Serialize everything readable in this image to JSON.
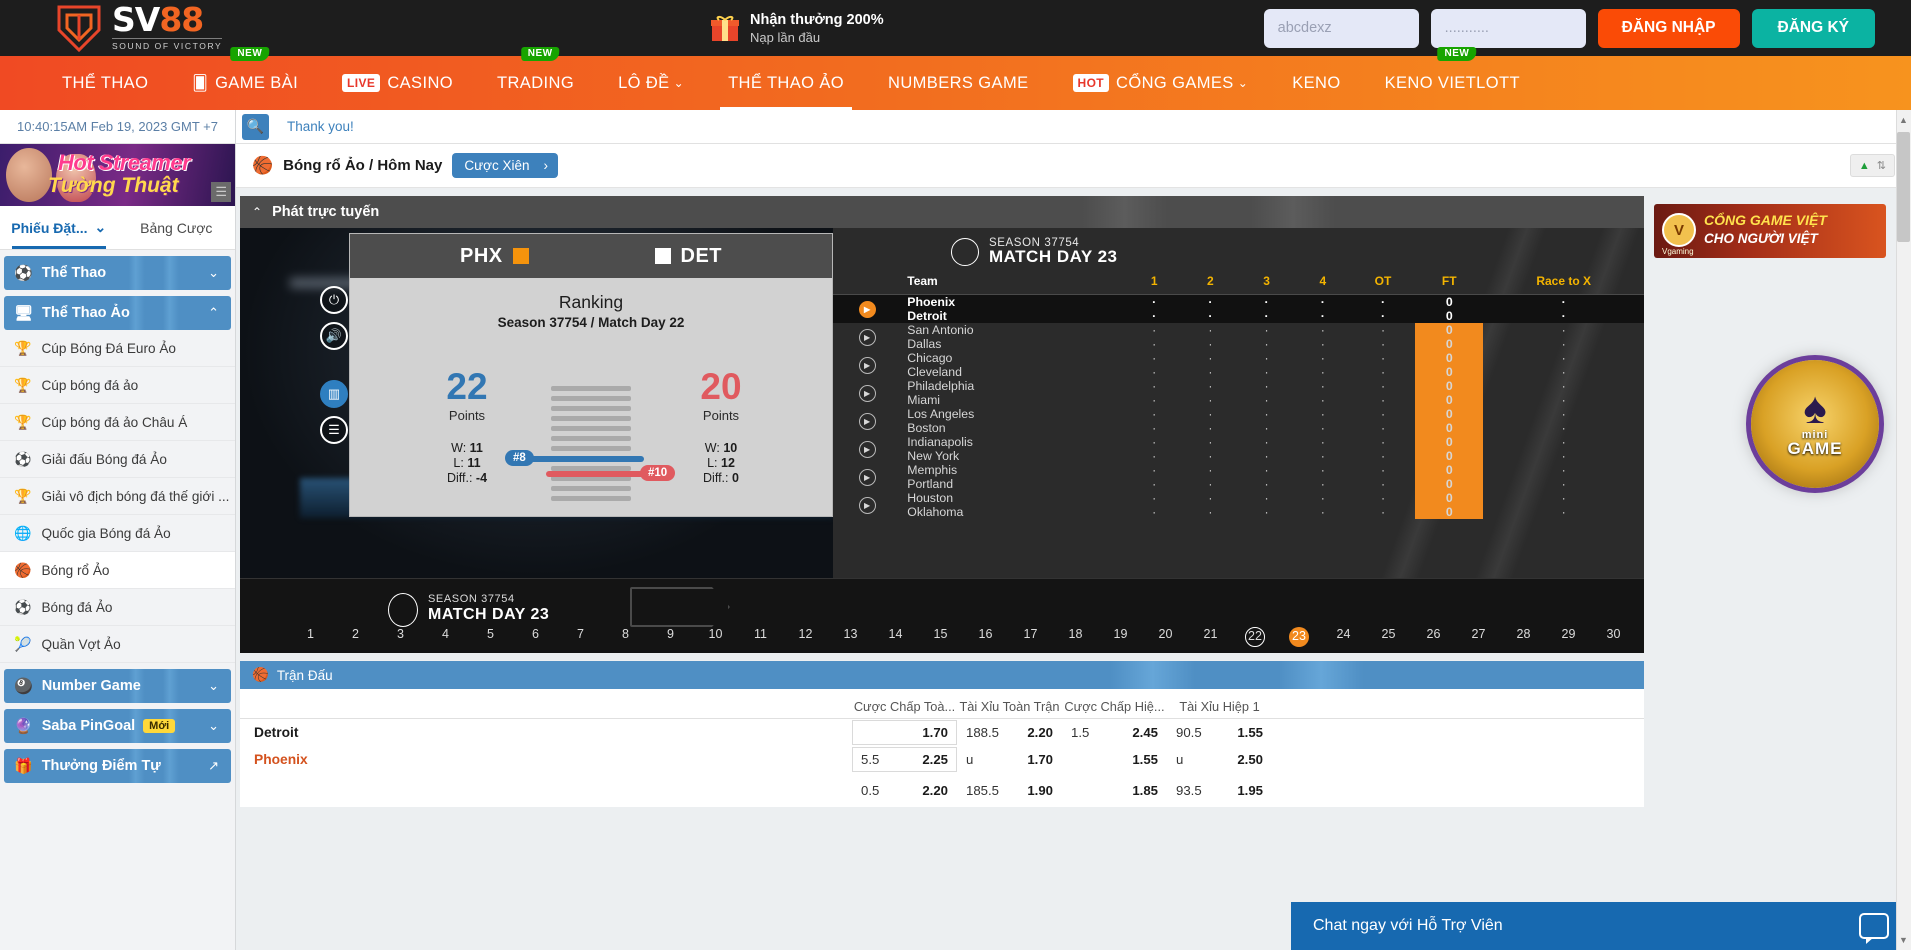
{
  "header": {
    "logo_name": "SV88",
    "logo_tagline": "SOUND OF VICTORY",
    "promo_title": "Nhận thưởng 200%",
    "promo_sub": "Nạp lần đầu",
    "username_value": "abcdexz",
    "username_placeholder": "abcdexz",
    "password_value": "...........",
    "login_label": "ĐĂNG NHẬP",
    "register_label": "ĐĂNG KÝ",
    "accent_orange": "#fa4b06",
    "accent_teal": "#0bb3a2"
  },
  "nav": {
    "items": [
      {
        "label": "THỂ THAO",
        "icon": "",
        "badge": "",
        "tag": "",
        "active": false
      },
      {
        "label": "GAME BÀI",
        "icon": "card-icon",
        "badge": "NEW",
        "tag": "",
        "active": false
      },
      {
        "label": "CASINO",
        "icon": "",
        "badge": "",
        "tag": "LIVE",
        "active": false
      },
      {
        "label": "TRADING",
        "icon": "",
        "badge": "NEW",
        "tag": "",
        "active": false
      },
      {
        "label": "LÔ ĐỀ",
        "icon": "",
        "badge": "",
        "tag": "",
        "caret": true,
        "active": false
      },
      {
        "label": "THỂ THAO ẢO",
        "icon": "",
        "badge": "",
        "tag": "",
        "active": true
      },
      {
        "label": "NUMBERS GAME",
        "icon": "",
        "badge": "",
        "tag": "",
        "active": false
      },
      {
        "label": "CỔNG GAMES",
        "icon": "",
        "badge": "",
        "tag": "HOT",
        "caret": true,
        "active": false
      },
      {
        "label": "KENO",
        "icon": "",
        "badge": "",
        "tag": "",
        "active": false
      },
      {
        "label": "KENO VIETLOTT",
        "icon": "",
        "badge": "NEW",
        "tag": "",
        "active": false
      }
    ]
  },
  "sidebar": {
    "clock": "10:40:15AM Feb 19, 2023 GMT +7",
    "banner_line1": "Hot Streamer",
    "banner_line2": "Tường Thuật",
    "tabs": [
      {
        "label": "Phiếu Đặt...",
        "active": true
      },
      {
        "label": "Bảng Cược",
        "active": false
      }
    ],
    "groups": [
      {
        "label": "Thể Thao",
        "icon": "sports-ball-icon",
        "expanded": false,
        "badge": "",
        "items": []
      },
      {
        "label": "Thể Thao Ảo",
        "icon": "virtual-sports-icon",
        "expanded": true,
        "badge": "",
        "items": [
          {
            "label": "Cúp Bóng Đá Euro Ảo",
            "icon": "trophy-icon",
            "selected": false
          },
          {
            "label": "Cúp bóng đá ảo",
            "icon": "trophy-icon",
            "selected": false
          },
          {
            "label": "Cúp bóng đá ảo Châu Á",
            "icon": "trophy-icon",
            "selected": false
          },
          {
            "label": "Giải đấu Bóng đá Ảo",
            "icon": "soccer-icon",
            "selected": false
          },
          {
            "label": "Giải vô địch bóng đá thế giới ...",
            "icon": "trophy-icon",
            "selected": false
          },
          {
            "label": "Quốc gia Bóng đá Ảo",
            "icon": "globe-soccer-icon",
            "selected": false
          },
          {
            "label": "Bóng rổ Ảo",
            "icon": "basketball-icon",
            "selected": true
          },
          {
            "label": "Bóng đá Ảo",
            "icon": "soccer-icon",
            "selected": false
          },
          {
            "label": "Quần Vợt Ảo",
            "icon": "tennis-icon",
            "selected": false
          }
        ]
      },
      {
        "label": "Number Game",
        "icon": "balls-icon",
        "expanded": false,
        "badge": "",
        "items": []
      },
      {
        "label": "Saba PinGoal",
        "icon": "pin-icon",
        "expanded": false,
        "badge": "Mới",
        "items": []
      },
      {
        "label": "Thưởng Điểm Tự",
        "icon": "gift-icon",
        "expanded": false,
        "badge": "",
        "items": []
      }
    ]
  },
  "search": {
    "icon": "search-icon",
    "message": "Thank you!"
  },
  "breadcrumb": {
    "icon": "basketball-icon",
    "text": "Bóng rổ Ảo / Hôm Nay",
    "pill_label": "Cược Xiên",
    "pill_arrow": "›",
    "sort_up": "▲",
    "sort_down": "⇅"
  },
  "stream": {
    "title": "Phát trực tuyến",
    "collapse_icon": "chevron-up-icon",
    "controls": [
      "power-icon",
      "volume-icon",
      "stats-icon",
      "list-icon"
    ]
  },
  "overlay": {
    "team_left": "PHX",
    "team_right": "DET",
    "color_left": "#f5930c",
    "color_right": "#ffffff",
    "title": "Ranking",
    "subtitle": "Season 37754 / Match Day 22",
    "left": {
      "points": "22",
      "points_label": "Points",
      "w_label": "W:",
      "w": "11",
      "l_label": "L:",
      "l": "11",
      "diff_label": "Diff.:",
      "diff": "-4",
      "rank": "#8",
      "color": "#3277b3"
    },
    "right": {
      "points": "20",
      "points_label": "Points",
      "w_label": "W:",
      "w": "10",
      "l_label": "L:",
      "l": "12",
      "diff_label": "Diff.:",
      "diff": "0",
      "rank": "#10",
      "color": "#e05a5f"
    }
  },
  "scoreboard": {
    "season": "SEASON 37754",
    "matchday": "MATCH DAY 23",
    "columns": [
      "Team",
      "1",
      "2",
      "3",
      "4",
      "OT",
      "FT",
      "Race to X"
    ],
    "rows": [
      {
        "home": "Phoenix",
        "away": "Detroit",
        "highlight": true,
        "playing": true,
        "home_cells": [
          "·",
          "·",
          "·",
          "·",
          "·"
        ],
        "away_cells": [
          "·",
          "·",
          "·",
          "·",
          "·"
        ],
        "home_ft": "0",
        "away_ft": "0",
        "home_race": "·",
        "away_race": "·"
      },
      {
        "home": "San Antonio",
        "away": "Dallas",
        "highlight": false,
        "playing": false,
        "home_cells": [
          "·",
          "·",
          "·",
          "·",
          "·"
        ],
        "away_cells": [
          "·",
          "·",
          "·",
          "·",
          "·"
        ],
        "home_ft": "0",
        "away_ft": "0",
        "home_race": "·",
        "away_race": "·"
      },
      {
        "home": "Chicago",
        "away": "Cleveland",
        "highlight": false,
        "playing": false,
        "home_cells": [
          "·",
          "·",
          "·",
          "·",
          "·"
        ],
        "away_cells": [
          "·",
          "·",
          "·",
          "·",
          "·"
        ],
        "home_ft": "0",
        "away_ft": "0",
        "home_race": "·",
        "away_race": "·"
      },
      {
        "home": "Philadelphia",
        "away": "Miami",
        "highlight": false,
        "playing": false,
        "home_cells": [
          "·",
          "·",
          "·",
          "·",
          "·"
        ],
        "away_cells": [
          "·",
          "·",
          "·",
          "·",
          "·"
        ],
        "home_ft": "0",
        "away_ft": "0",
        "home_race": "·",
        "away_race": "·"
      },
      {
        "home": "Los Angeles",
        "away": "Boston",
        "highlight": false,
        "playing": false,
        "home_cells": [
          "·",
          "·",
          "·",
          "·",
          "·"
        ],
        "away_cells": [
          "·",
          "·",
          "·",
          "·",
          "·"
        ],
        "home_ft": "0",
        "away_ft": "0",
        "home_race": "·",
        "away_race": "·"
      },
      {
        "home": "Indianapolis",
        "away": "New York",
        "highlight": false,
        "playing": false,
        "home_cells": [
          "·",
          "·",
          "·",
          "·",
          "·"
        ],
        "away_cells": [
          "·",
          "·",
          "·",
          "·",
          "·"
        ],
        "home_ft": "0",
        "away_ft": "0",
        "home_race": "·",
        "away_race": "·"
      },
      {
        "home": "Memphis",
        "away": "Portland",
        "highlight": false,
        "playing": false,
        "home_cells": [
          "·",
          "·",
          "·",
          "·",
          "·"
        ],
        "away_cells": [
          "·",
          "·",
          "·",
          "·",
          "·"
        ],
        "home_ft": "0",
        "away_ft": "0",
        "home_race": "·",
        "away_race": "·"
      },
      {
        "home": "Houston",
        "away": "Oklahoma",
        "highlight": false,
        "playing": false,
        "home_cells": [
          "·",
          "·",
          "·",
          "·",
          "·"
        ],
        "away_cells": [
          "·",
          "·",
          "·",
          "·",
          "·"
        ],
        "home_ft": "0",
        "away_ft": "0",
        "home_race": "·",
        "away_race": "·"
      }
    ]
  },
  "matchday_strip": {
    "season": "SEASON 37754",
    "matchday": "MATCH DAY 23",
    "days": [
      "1",
      "2",
      "3",
      "4",
      "5",
      "6",
      "7",
      "8",
      "9",
      "10",
      "11",
      "12",
      "13",
      "14",
      "15",
      "16",
      "17",
      "18",
      "19",
      "20",
      "21",
      "22",
      "23",
      "24",
      "25",
      "26",
      "27",
      "28",
      "29",
      "30"
    ],
    "ring_day": "22",
    "current_day": "23"
  },
  "match_table": {
    "title": "Trận Đấu",
    "icon": "basketball-icon",
    "columns": [
      "Cược Chấp Toà...",
      "Tài Xỉu Toàn Trận",
      "Cược Chấp Hiệ...",
      "Tài Xỉu Hiệp 1"
    ],
    "rows": [
      {
        "team": "Detroit",
        "type": "home",
        "cells": [
          {
            "hdp": "",
            "val": "1.70",
            "boxed": true
          },
          {
            "hdp": "188.5",
            "val": "2.20",
            "boxed": false
          },
          {
            "hdp": "1.5",
            "val": "2.45",
            "boxed": false
          },
          {
            "hdp": "90.5",
            "val": "1.55",
            "boxed": false
          }
        ]
      },
      {
        "team": "Phoenix",
        "type": "away",
        "cells": [
          {
            "hdp": "5.5",
            "val": "2.25",
            "boxed": true
          },
          {
            "hdp": "u",
            "val": "1.70",
            "boxed": false
          },
          {
            "hdp": "",
            "val": "1.55",
            "boxed": false
          },
          {
            "hdp": "u",
            "val": "2.50",
            "boxed": false
          }
        ]
      },
      {
        "team": "",
        "type": "home",
        "cells": [
          {
            "hdp": "0.5",
            "val": "2.20",
            "boxed": false
          },
          {
            "hdp": "185.5",
            "val": "1.90",
            "boxed": false
          },
          {
            "hdp": "",
            "val": "1.85",
            "boxed": false
          },
          {
            "hdp": "93.5",
            "val": "1.95",
            "boxed": false
          }
        ]
      }
    ]
  },
  "rail": {
    "ad_title": "CỔNG GAME VIỆT",
    "ad_sub": "CHO NGƯỜI VIỆT",
    "ad_brand": "Vgaming",
    "ad_badge": "V",
    "minigame_line1": "mini",
    "minigame_line2": "GAME",
    "minigame_icon": "spade-icon"
  },
  "chat": {
    "label": "Chat ngay với Hỗ Trợ Viên",
    "icon": "chat-bubble-icon"
  }
}
